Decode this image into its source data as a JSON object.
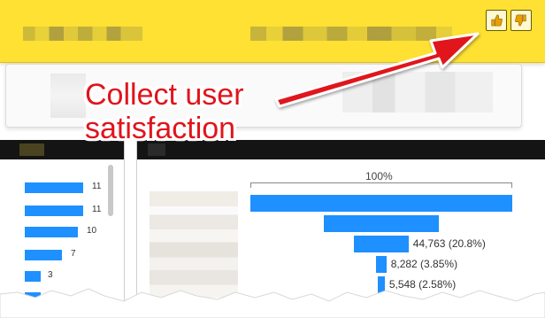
{
  "header": {
    "like_icon": "thumbs-up-icon",
    "dislike_icon": "thumbs-down-icon"
  },
  "callout": {
    "line1": "Collect user",
    "line2": "satisfaction"
  },
  "left_chart": {
    "values": [
      "11",
      "11",
      "10",
      "7",
      "3",
      "3"
    ]
  },
  "funnel": {
    "top_label": "100%",
    "rows": [
      {
        "label": "",
        "fraction": 1.0
      },
      {
        "label": "",
        "fraction": 0.44
      },
      {
        "label": "44,763 (20.8%)",
        "fraction": 0.208
      },
      {
        "label": "8,282 (3.85%)",
        "fraction": 0.0385
      },
      {
        "label": "5,548 (2.58%)",
        "fraction": 0.0258
      }
    ]
  },
  "colors": {
    "banner": "#ffe133",
    "bar": "#1e90ff",
    "callout": "#e0141c",
    "arrow": "#e0141c"
  }
}
